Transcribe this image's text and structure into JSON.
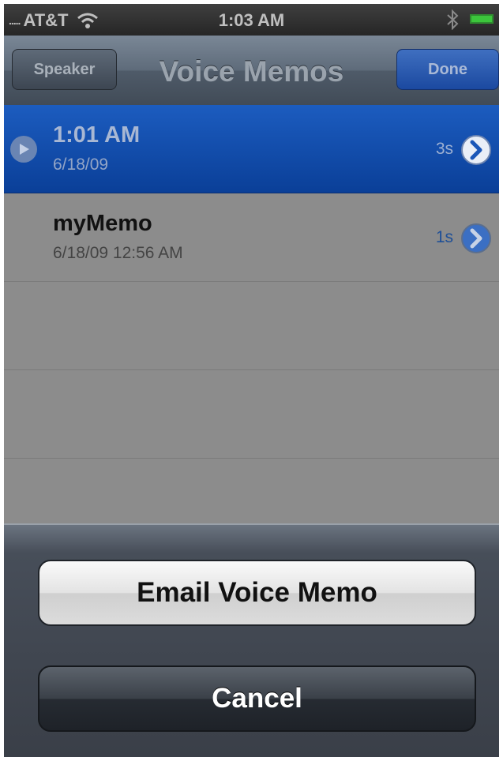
{
  "status_bar": {
    "carrier_dots": ".....",
    "carrier": "AT&T",
    "time": "1:03 AM",
    "icons": [
      "wifi-icon",
      "bluetooth-icon",
      "battery-icon"
    ]
  },
  "nav": {
    "title": "Voice Memos",
    "left_button": "Speaker",
    "right_button": "Done"
  },
  "memos": [
    {
      "title": "1:01 AM",
      "subtitle": "6/18/09",
      "duration": "3s",
      "selected": true
    },
    {
      "title": "myMemo",
      "subtitle": "6/18/09 12:56 AM",
      "duration": "1s",
      "selected": false
    }
  ],
  "action_sheet": {
    "email_button": "Email Voice Memo",
    "cancel_button": "Cancel"
  },
  "colors": {
    "selected_row": "#0a3f98",
    "done_button": "#1b49a0",
    "battery": "#3cc63c"
  }
}
